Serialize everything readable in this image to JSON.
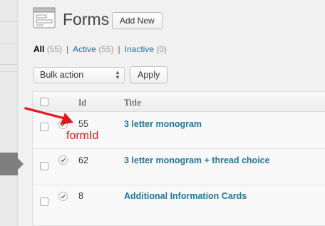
{
  "header": {
    "title": "Forms",
    "add_new_label": "Add New",
    "icon": "forms-icon"
  },
  "filters": [
    {
      "label": "All",
      "count": "(55)",
      "current": true
    },
    {
      "label": "Active",
      "count": "(55)",
      "current": false
    },
    {
      "label": "Inactive",
      "count": "(0)",
      "current": false
    }
  ],
  "filter_separator": "|",
  "bulk": {
    "selected": "Bulk action",
    "apply_label": "Apply"
  },
  "table": {
    "columns": {
      "id": "Id",
      "title": "Title"
    },
    "rows": [
      {
        "id": "55",
        "title": "3 letter monogram",
        "status_icon": "check-circle-icon"
      },
      {
        "id": "62",
        "title": "3 letter monogram + thread choice",
        "status_icon": "check-circle-icon"
      },
      {
        "id": "8",
        "title": "Additional Information Cards",
        "status_icon": "check-circle-icon"
      }
    ]
  },
  "annotation": {
    "label": "formId",
    "color": "#e8131c"
  },
  "colors": {
    "link": "#21759b",
    "check": "#2e8b2e"
  }
}
